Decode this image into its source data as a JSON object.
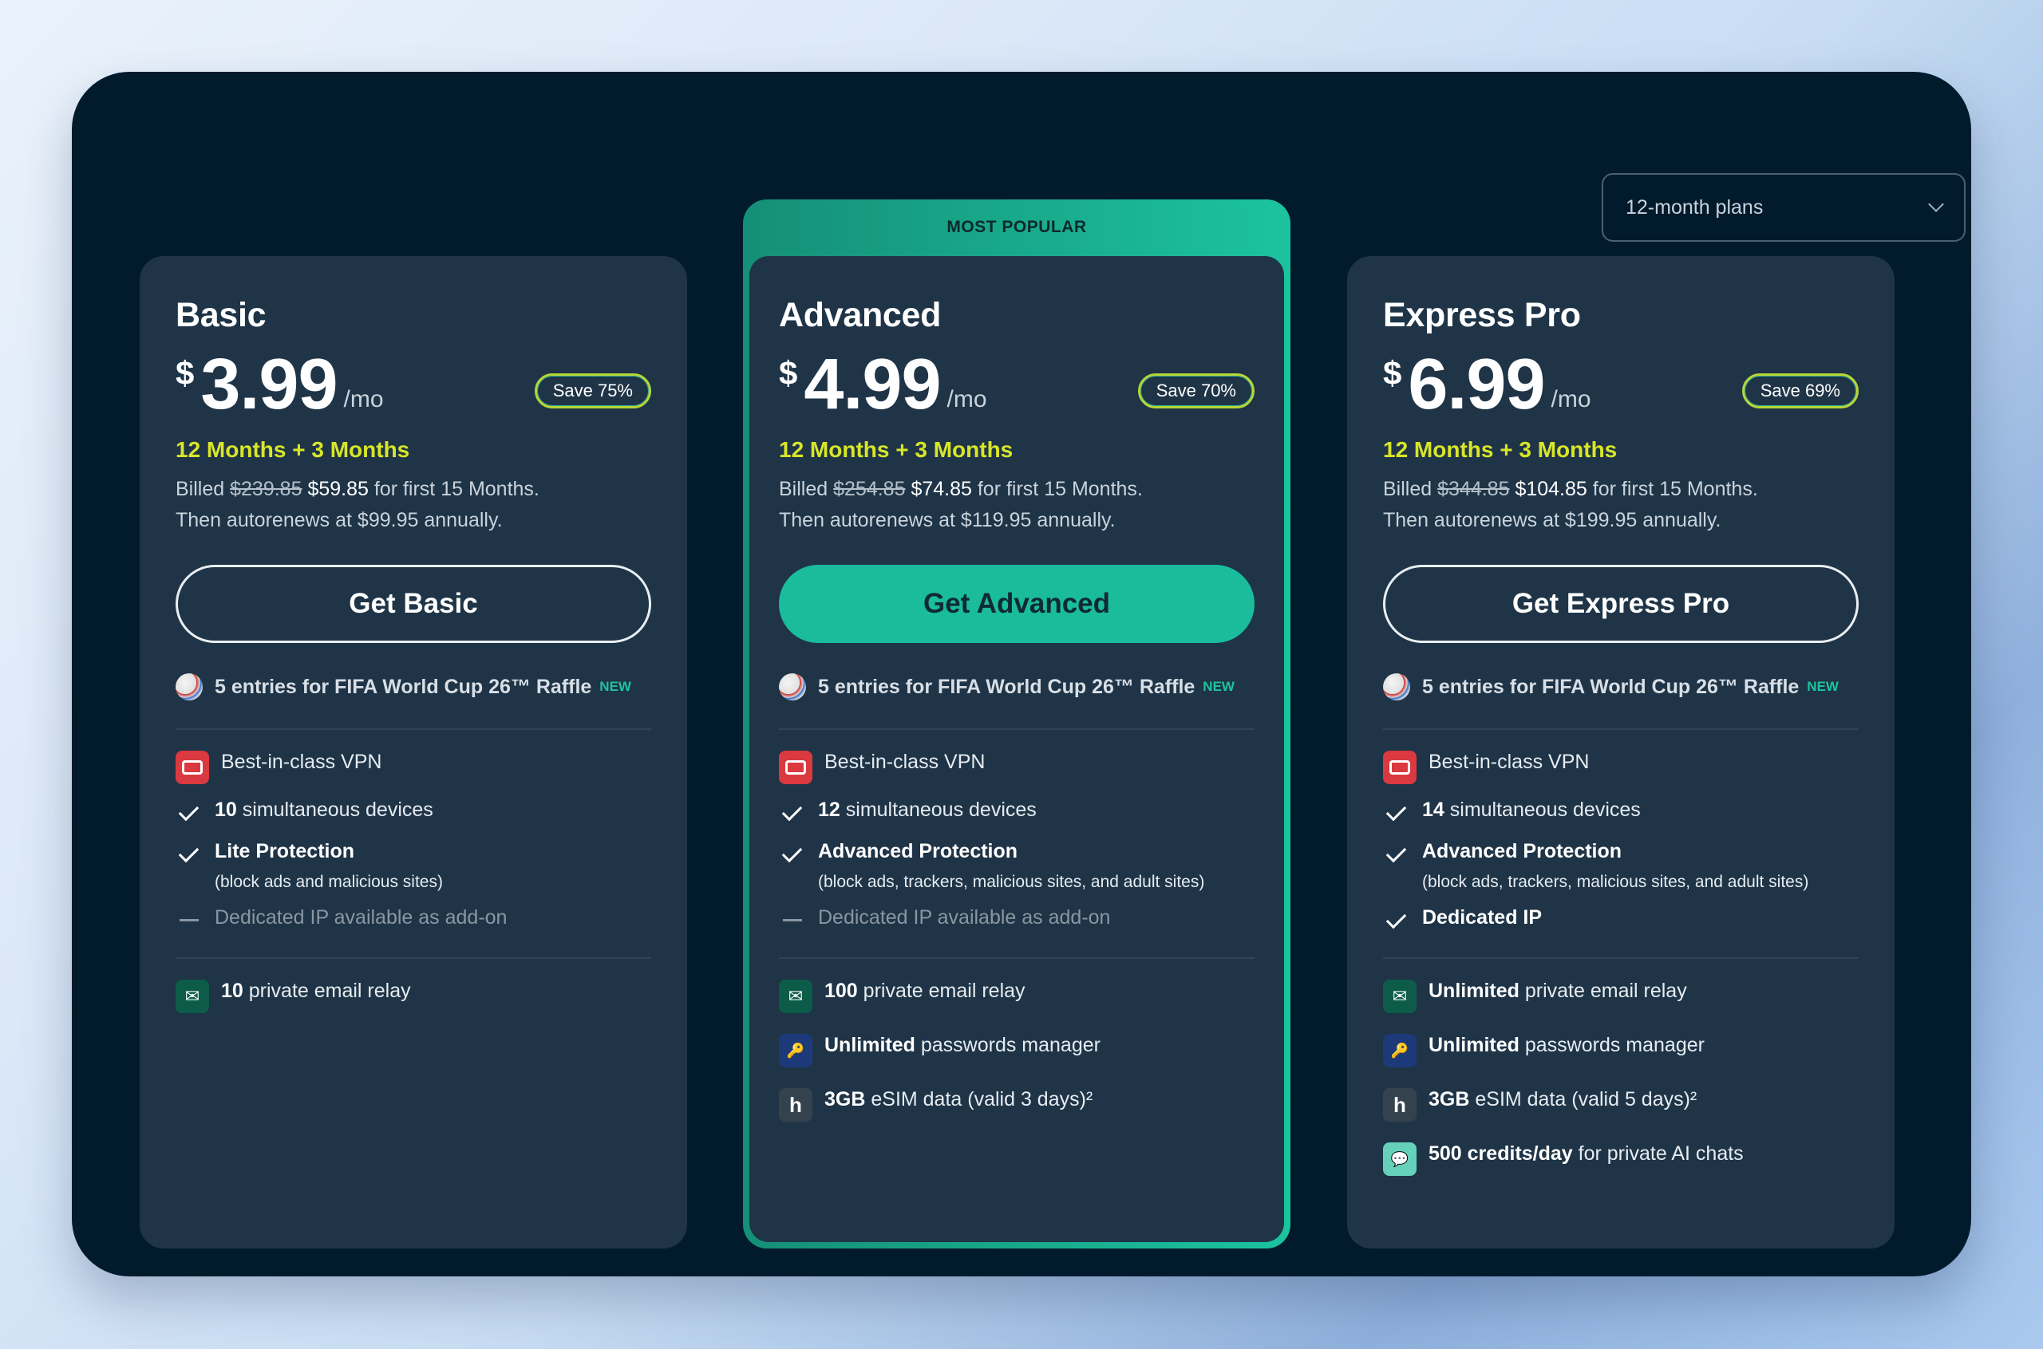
{
  "plan_selector": {
    "label": "12-month plans"
  },
  "popular_label": "MOST POPULAR",
  "plans": [
    {
      "title": "Basic",
      "currency": "$",
      "price": "3.99",
      "per": "/mo",
      "save": "Save 75%",
      "months": "12 Months + 3 Months",
      "billed_prefix": "Billed",
      "billed_old": "$239.85",
      "billed_new": "$59.85",
      "billed_suffix": "for first 15 Months.",
      "renew": "Then autorenews at $99.95 annually.",
      "cta": "Get Basic",
      "raffle": "5 entries for FIFA World Cup 26™ Raffle",
      "raffle_badge": "NEW",
      "vpn": "Best-in-class VPN",
      "devices_num": "10",
      "devices_text": "simultaneous devices",
      "protection": "Lite Protection",
      "protection_sub": "(block ads and malicious sites)",
      "dedicated": "Dedicated IP available as add-on",
      "email_num": "10",
      "email_text": "private email relay"
    },
    {
      "title": "Advanced",
      "currency": "$",
      "price": "4.99",
      "per": "/mo",
      "save": "Save 70%",
      "months": "12 Months + 3 Months",
      "billed_prefix": "Billed",
      "billed_old": "$254.85",
      "billed_new": "$74.85",
      "billed_suffix": "for first 15 Months.",
      "renew": "Then autorenews at $119.95 annually.",
      "cta": "Get Advanced",
      "raffle": "5 entries for FIFA World Cup 26™ Raffle",
      "raffle_badge": "NEW",
      "vpn": "Best-in-class VPN",
      "devices_num": "12",
      "devices_text": "simultaneous devices",
      "protection": "Advanced Protection",
      "protection_sub": "(block ads, trackers, malicious sites, and adult sites)",
      "dedicated": "Dedicated IP available as add-on",
      "email_num": "100",
      "email_text": "private email relay",
      "pw_num": "Unlimited",
      "pw_text": "passwords manager",
      "esim_num": "3GB",
      "esim_text": "eSIM data (valid 3 days)²"
    },
    {
      "title": "Express Pro",
      "currency": "$",
      "price": "6.99",
      "per": "/mo",
      "save": "Save 69%",
      "months": "12 Months + 3 Months",
      "billed_prefix": "Billed",
      "billed_old": "$344.85",
      "billed_new": "$104.85",
      "billed_suffix": "for first 15 Months.",
      "renew": "Then autorenews at $199.95 annually.",
      "cta": "Get Express Pro",
      "raffle": "5 entries for FIFA World Cup 26™ Raffle",
      "raffle_badge": "NEW",
      "vpn": "Best-in-class VPN",
      "devices_num": "14",
      "devices_text": "simultaneous devices",
      "protection": "Advanced Protection",
      "protection_sub": "(block ads, trackers, malicious sites, and adult sites)",
      "dedicated": "Dedicated IP",
      "email_num": "Unlimited",
      "email_text": "private email relay",
      "pw_num": "Unlimited",
      "pw_text": "passwords manager",
      "esim_num": "3GB",
      "esim_text": "eSIM data (valid 5 days)²",
      "ai_num": "500 credits/day",
      "ai_text": "for private AI chats"
    }
  ],
  "colors": {
    "panel": "#011b2d",
    "card": "#1f3447",
    "accent": "#1abc9b",
    "highlight": "#d8e628"
  }
}
